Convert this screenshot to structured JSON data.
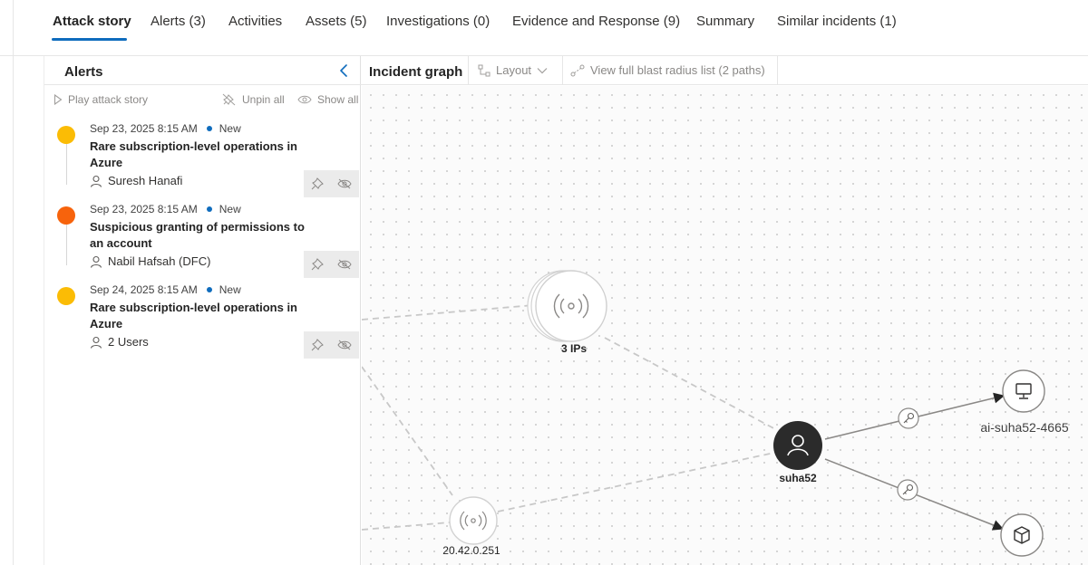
{
  "tabs": [
    {
      "label": "Attack story",
      "active": true
    },
    {
      "label": "Alerts (3)"
    },
    {
      "label": "Activities"
    },
    {
      "label": "Assets (5)"
    },
    {
      "label": "Investigations (0)"
    },
    {
      "label": "Evidence and Response (9)"
    },
    {
      "label": "Summary"
    },
    {
      "label": "Similar incidents (1)"
    }
  ],
  "alerts_panel": {
    "title": "Alerts",
    "collapse_icon": "chevron-left-icon",
    "toolbar": {
      "play_label": "Play attack story",
      "unpin_label": "Unpin all",
      "show_label": "Show all"
    },
    "items": [
      {
        "date": "Sep 23, 2025 8:15 AM",
        "status": "New",
        "title": "Rare subscription-level operations in Azure",
        "entity": "Suresh Hanafi",
        "severity_color": "#fbbc05"
      },
      {
        "date": "Sep 23, 2025 8:15 AM",
        "status": "New",
        "title": "Suspicious granting of permissions to an account",
        "entity": "Nabil Hafsah (DFC)",
        "severity_color": "#f7630c"
      },
      {
        "date": "Sep 24, 2025 8:15 AM",
        "status": "New",
        "title": "Rare subscription-level operations in Azure",
        "entity": "2 Users",
        "severity_color": "#fbbc05"
      }
    ]
  },
  "graph": {
    "title": "Incident graph",
    "layout_label": "Layout",
    "blast_label": "View full blast radius list (2 paths)",
    "nodes": {
      "ips": "3 IPs",
      "ip_single": "20.42.0.251",
      "user": "suha52",
      "device": "ai-suha52-4665"
    }
  },
  "colors": {
    "accent": "#0f6cbd",
    "severity_medium": "#fbbc05",
    "severity_high": "#f7630c",
    "user_node": "#2b2b2b"
  }
}
